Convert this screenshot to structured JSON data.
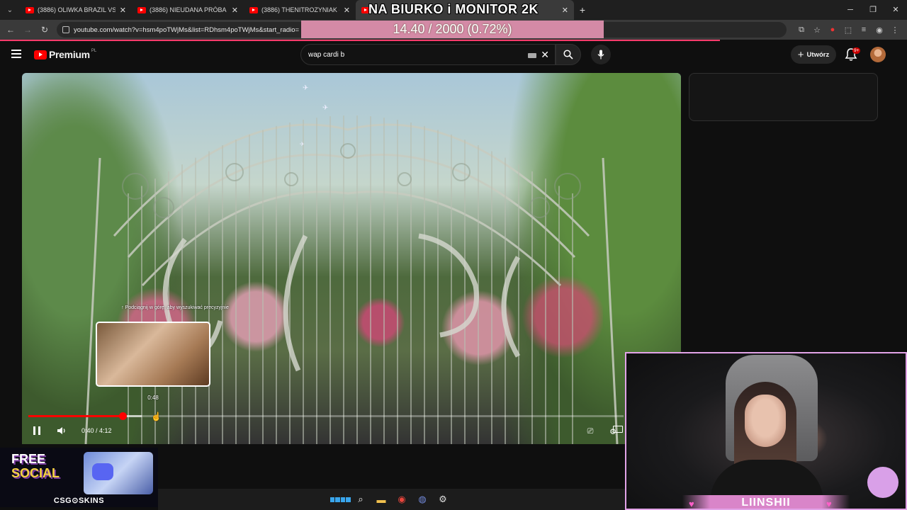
{
  "browser": {
    "tabs": [
      {
        "title": "(3886) OLIWKA BRAZIL VS NAT"
      },
      {
        "title": "(3886) NIEUDANA PRÓBA POP"
      },
      {
        "title": "(3886) THENITROZYNIAK - KŁA"
      },
      {
        "title": ""
      }
    ],
    "url": "youtube.com/watch?v=hsm4poTWjMs&list=RDhsm4poTWjMs&start_radio="
  },
  "stream_overlay": {
    "title": "NA BIURKO i MONITOR 2K",
    "progress_text": "14.40 / 2000 (0.72%)",
    "progress_fraction": 0.0072
  },
  "youtube": {
    "logo_text": "Premium",
    "country_code": "PL",
    "search_value": "wap cardi b",
    "create_label": "Utwórz",
    "notification_badge": "9+"
  },
  "player": {
    "seek_hint": "↑ Podciągnij w górę, aby wyszukiwać precyzyjnie",
    "preview_time": "0:48",
    "time_display": "0:40 / 4:12",
    "current_seconds": 40,
    "hover_seconds": 48,
    "duration_seconds": 252
  },
  "promo": {
    "free_label": "FREE",
    "social_label": "SOCIAL",
    "brand": "CSG⊙SKINS"
  },
  "webcam": {
    "streamer_name": "LIINSHII"
  },
  "colors": {
    "accent": "#ff0000",
    "overlay_bar": "#d48aa6",
    "cam_border": "#e2a3e8"
  }
}
